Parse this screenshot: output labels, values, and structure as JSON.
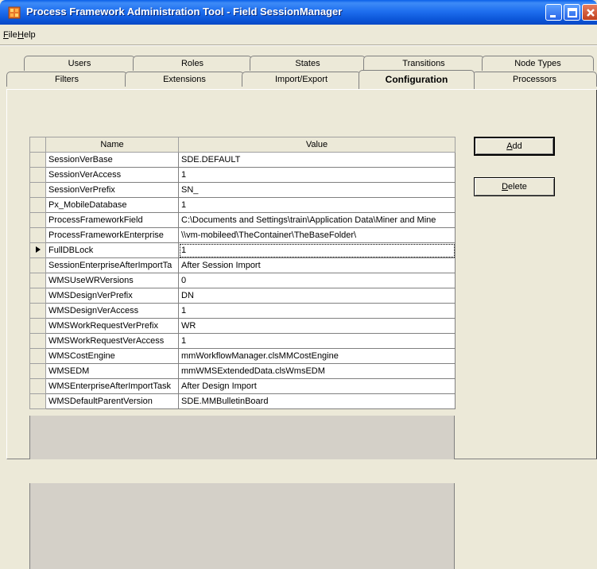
{
  "window": {
    "title": "Process Framework Administration Tool - Field SessionManager"
  },
  "menu": [
    {
      "label": "File",
      "accel": "F",
      "rest": "ile"
    },
    {
      "label": "Help",
      "accel": "H",
      "rest": "elp"
    }
  ],
  "tabs_back": [
    "Users",
    "Roles",
    "States",
    "Transitions",
    "Node Types"
  ],
  "tabs_front": [
    "Filters",
    "Extensions",
    "Import/Export",
    "Configuration",
    "Processors"
  ],
  "active_tab": "Configuration",
  "grid": {
    "columns": [
      "Name",
      "Value"
    ],
    "rows": [
      {
        "name": "SessionVerBase",
        "value": "SDE.DEFAULT"
      },
      {
        "name": "SessionVerAccess",
        "value": "1"
      },
      {
        "name": "SessionVerPrefix",
        "value": "SN_"
      },
      {
        "name": "Px_MobileDatabase",
        "value": "1"
      },
      {
        "name": "ProcessFrameworkField",
        "value": "C:\\Documents and Settings\\train\\Application Data\\Miner and Mine"
      },
      {
        "name": "ProcessFrameworkEnterprise",
        "value": "\\\\vm-mobileed\\TheContainer\\TheBaseFolder\\"
      },
      {
        "name": "FullDBLock",
        "value": "1"
      },
      {
        "name": "SessionEnterpriseAfterImportTa",
        "value": "After Session Import"
      },
      {
        "name": "WMSUseWRVersions",
        "value": "0"
      },
      {
        "name": "WMSDesignVerPrefix",
        "value": "DN"
      },
      {
        "name": "WMSDesignVerAccess",
        "value": "1"
      },
      {
        "name": "WMSWorkRequestVerPrefix",
        "value": "WR"
      },
      {
        "name": "WMSWorkRequestVerAccess",
        "value": "1"
      },
      {
        "name": "WMSCostEngine",
        "value": "mmWorkflowManager.clsMMCostEngine"
      },
      {
        "name": "WMSEDM",
        "value": "mmWMSExtendedData.clsWmsEDM"
      },
      {
        "name": "WMSEnterpriseAfterImportTask",
        "value": "After Design Import"
      },
      {
        "name": "WMSDefaultParentVersion",
        "value": "SDE.MMBulletinBoard"
      }
    ],
    "current_row": 6
  },
  "buttons": {
    "add": {
      "accel": "A",
      "rest": "dd"
    },
    "delete": {
      "accel": "D",
      "rest": "elete"
    }
  },
  "colors": {
    "titlebar": "#0b55d8",
    "window_bg": "#ece9d8",
    "grid_bg": "#d4d0c8"
  }
}
